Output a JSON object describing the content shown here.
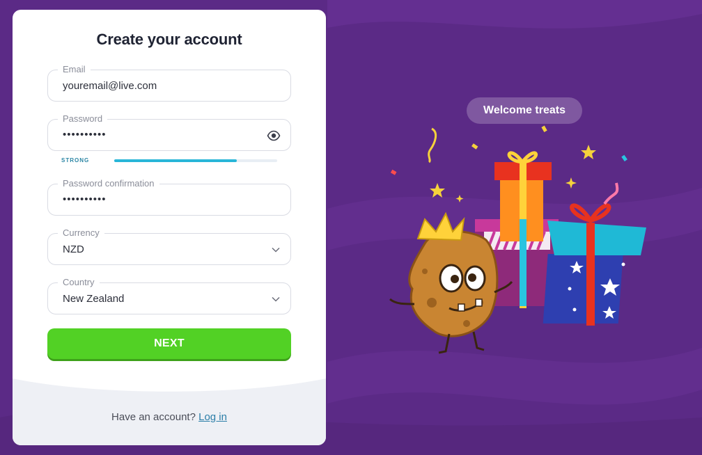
{
  "form": {
    "title": "Create your account",
    "email": {
      "label": "Email",
      "value": "youremail@live.com"
    },
    "password": {
      "label": "Password",
      "value": "••••••••••",
      "strength_label": "STRONG",
      "strength_fraction": 0.75,
      "toggle_icon": "eye-icon"
    },
    "password_confirmation": {
      "label": "Password confirmation",
      "value": "••••••••••"
    },
    "currency": {
      "label": "Currency",
      "value": "NZD",
      "icon": "chevron-down-icon"
    },
    "country": {
      "label": "Country",
      "value": "New Zealand",
      "icon": "chevron-down-icon"
    },
    "next_label": "NEXT",
    "footer_prompt": "Have an account?",
    "login_label": "Log in"
  },
  "promo": {
    "badge": "Welcome treats",
    "illustration": "cookie-mascot-with-gift-boxes"
  },
  "colors": {
    "background": "#5b2a86",
    "primary_button": "#52d125",
    "strength_bar": "#29b6d8",
    "link": "#2b7ea8"
  }
}
